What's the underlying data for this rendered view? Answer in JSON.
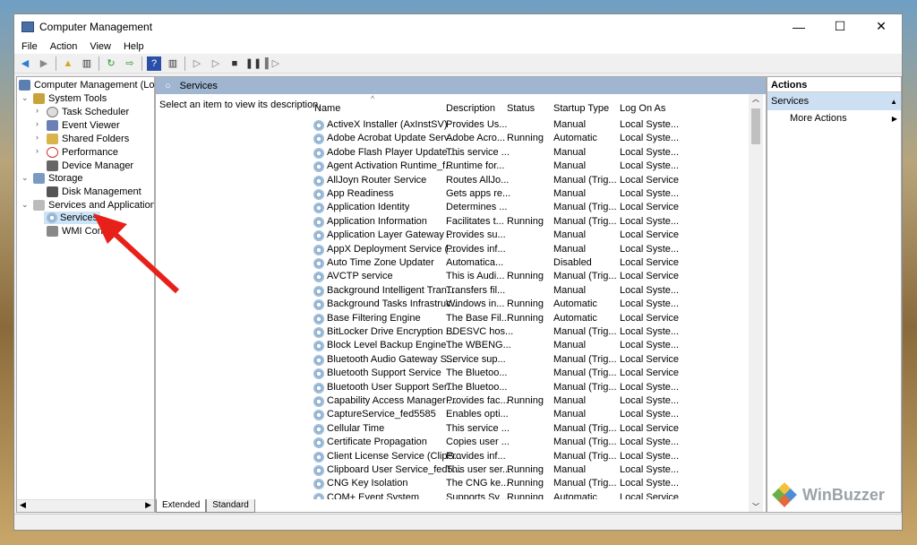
{
  "window": {
    "title": "Computer Management",
    "minimize": "—",
    "maximize": "☐",
    "close": "✕"
  },
  "menu": [
    "File",
    "Action",
    "View",
    "Help"
  ],
  "tree": {
    "root": "Computer Management (Local",
    "system_tools": "System Tools",
    "task_scheduler": "Task Scheduler",
    "event_viewer": "Event Viewer",
    "shared_folders": "Shared Folders",
    "performance": "Performance",
    "device_manager": "Device Manager",
    "storage": "Storage",
    "disk_management": "Disk Management",
    "services_apps": "Services and Applications",
    "services": "Services",
    "wmi": "WMI Cont"
  },
  "center": {
    "header": "Services",
    "description_hint": "Select an item to view its description.",
    "columns": [
      "Name",
      "Description",
      "Status",
      "Startup Type",
      "Log On As"
    ],
    "rows": [
      [
        "ActiveX Installer (AxInstSV)",
        "Provides Us...",
        "",
        "Manual",
        "Local Syste..."
      ],
      [
        "Adobe Acrobat Update Serv...",
        "Adobe Acro...",
        "Running",
        "Automatic",
        "Local Syste..."
      ],
      [
        "Adobe Flash Player Update ...",
        "This service ...",
        "",
        "Manual",
        "Local Syste..."
      ],
      [
        "Agent Activation Runtime_f...",
        "Runtime for...",
        "",
        "Manual",
        "Local Syste..."
      ],
      [
        "AllJoyn Router Service",
        "Routes AllJo...",
        "",
        "Manual (Trig...",
        "Local Service"
      ],
      [
        "App Readiness",
        "Gets apps re...",
        "",
        "Manual",
        "Local Syste..."
      ],
      [
        "Application Identity",
        "Determines ...",
        "",
        "Manual (Trig...",
        "Local Service"
      ],
      [
        "Application Information",
        "Facilitates t...",
        "Running",
        "Manual (Trig...",
        "Local Syste..."
      ],
      [
        "Application Layer Gateway ...",
        "Provides su...",
        "",
        "Manual",
        "Local Service"
      ],
      [
        "AppX Deployment Service (...",
        "Provides inf...",
        "",
        "Manual",
        "Local Syste..."
      ],
      [
        "Auto Time Zone Updater",
        "Automatica...",
        "",
        "Disabled",
        "Local Service"
      ],
      [
        "AVCTP service",
        "This is Audi...",
        "Running",
        "Manual (Trig...",
        "Local Service"
      ],
      [
        "Background Intelligent Tran...",
        "Transfers fil...",
        "",
        "Manual",
        "Local Syste..."
      ],
      [
        "Background Tasks Infrastruc...",
        "Windows in...",
        "Running",
        "Automatic",
        "Local Syste..."
      ],
      [
        "Base Filtering Engine",
        "The Base Fil...",
        "Running",
        "Automatic",
        "Local Service"
      ],
      [
        "BitLocker Drive Encryption ...",
        "BDESVC hos...",
        "",
        "Manual (Trig...",
        "Local Syste..."
      ],
      [
        "Block Level Backup Engine ...",
        "The WBENG...",
        "",
        "Manual",
        "Local Syste..."
      ],
      [
        "Bluetooth Audio Gateway S...",
        "Service sup...",
        "",
        "Manual (Trig...",
        "Local Service"
      ],
      [
        "Bluetooth Support Service",
        "The Bluetoo...",
        "",
        "Manual (Trig...",
        "Local Service"
      ],
      [
        "Bluetooth User Support Ser...",
        "The Bluetoo...",
        "",
        "Manual (Trig...",
        "Local Syste..."
      ],
      [
        "Capability Access Manager ...",
        "Provides fac...",
        "Running",
        "Manual",
        "Local Syste..."
      ],
      [
        "CaptureService_fed5585",
        "Enables opti...",
        "",
        "Manual",
        "Local Syste..."
      ],
      [
        "Cellular Time",
        "This service ...",
        "",
        "Manual (Trig...",
        "Local Service"
      ],
      [
        "Certificate Propagation",
        "Copies user ...",
        "",
        "Manual (Trig...",
        "Local Syste..."
      ],
      [
        "Client License Service (ClipS...",
        "Provides inf...",
        "",
        "Manual (Trig...",
        "Local Syste..."
      ],
      [
        "Clipboard User Service_fed5...",
        "This user ser...",
        "Running",
        "Manual",
        "Local Syste..."
      ],
      [
        "CNG Key Isolation",
        "The CNG ke...",
        "Running",
        "Manual (Trig...",
        "Local Syste..."
      ],
      [
        "COM+ Event System",
        "Supports Sy...",
        "Running",
        "Automatic",
        "Local Service"
      ]
    ],
    "tabs": [
      "Extended",
      "Standard"
    ]
  },
  "actions": {
    "title": "Actions",
    "section": "Services",
    "more": "More Actions"
  },
  "watermark": "WinBuzzer"
}
